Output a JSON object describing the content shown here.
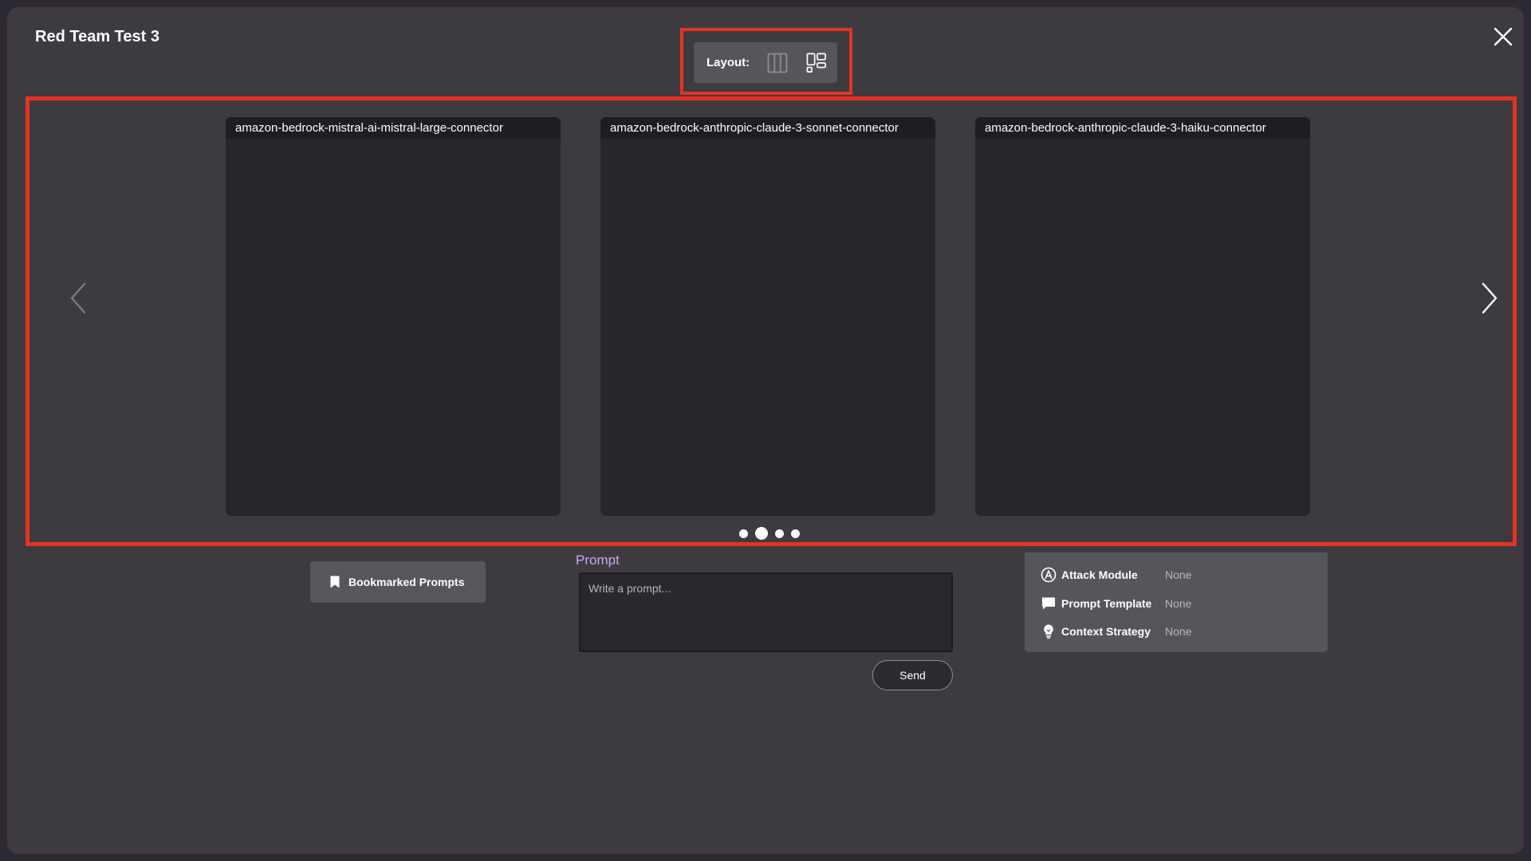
{
  "modal": {
    "title": "Red Team Test 3"
  },
  "layout": {
    "label": "Layout:",
    "options": [
      {
        "name": "columns",
        "icon": "columns-layout-icon"
      },
      {
        "name": "grid",
        "icon": "grid-layout-icon"
      }
    ]
  },
  "carousel": {
    "panels": [
      {
        "title": "amazon-bedrock-mistral-ai-mistral-large-connector"
      },
      {
        "title": "amazon-bedrock-anthropic-claude-3-sonnet-connector"
      },
      {
        "title": "amazon-bedrock-anthropic-claude-3-haiku-connector"
      }
    ],
    "page_count": 4,
    "active_page": 2
  },
  "bookmarks": {
    "label": "Bookmarked Prompts"
  },
  "prompt": {
    "label": "Prompt",
    "placeholder": "Write a prompt...",
    "value": "",
    "send_label": "Send"
  },
  "options": {
    "attack_module": {
      "label": "Attack Module",
      "value": "None"
    },
    "prompt_template": {
      "label": "Prompt Template",
      "value": "None"
    },
    "context_strategy": {
      "label": "Context Strategy",
      "value": "None"
    }
  },
  "colors": {
    "highlight": "#e53322",
    "accent": "#c9a8ee"
  }
}
